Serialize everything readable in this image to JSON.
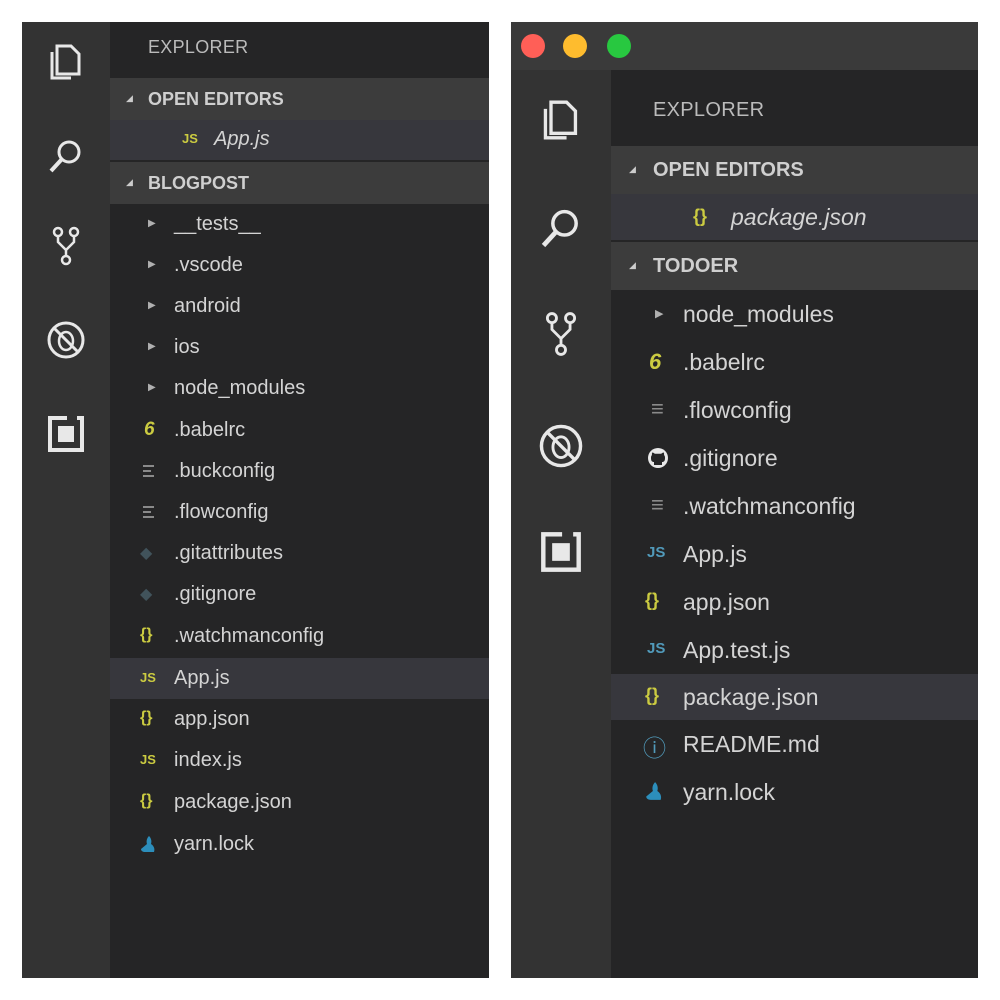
{
  "left": {
    "explorer_title": "EXPLORER",
    "open_editors": {
      "label": "OPEN EDITORS",
      "files": [
        {
          "icon": "js-icon",
          "badge": "JS",
          "name": "App.js"
        }
      ]
    },
    "project": {
      "label": "BLOGPOST",
      "items": [
        {
          "icon": "chevron-right-icon",
          "badge": "▶",
          "name": "__tests__",
          "type": "folder"
        },
        {
          "icon": "chevron-right-icon",
          "badge": "▶",
          "name": ".vscode",
          "type": "folder"
        },
        {
          "icon": "chevron-right-icon",
          "badge": "▶",
          "name": "android",
          "type": "folder"
        },
        {
          "icon": "chevron-right-icon",
          "badge": "▶",
          "name": "ios",
          "type": "folder"
        },
        {
          "icon": "chevron-right-icon",
          "badge": "▶",
          "name": "node_modules",
          "type": "folder"
        },
        {
          "icon": "babel-icon",
          "badge": "6",
          "name": ".babelrc"
        },
        {
          "icon": "config-file-icon",
          "badge": "",
          "name": ".buckconfig"
        },
        {
          "icon": "config-file-icon",
          "badge": "",
          "name": ".flowconfig"
        },
        {
          "icon": "git-icon",
          "badge": "◆",
          "name": ".gitattributes"
        },
        {
          "icon": "git-icon",
          "badge": "◆",
          "name": ".gitignore"
        },
        {
          "icon": "json-icon",
          "badge": "{}",
          "name": ".watchmanconfig"
        },
        {
          "icon": "js-icon",
          "badge": "JS",
          "name": "App.js",
          "selected": true
        },
        {
          "icon": "json-icon",
          "badge": "{}",
          "name": "app.json"
        },
        {
          "icon": "js-icon",
          "badge": "JS",
          "name": "index.js"
        },
        {
          "icon": "json-icon",
          "badge": "{}",
          "name": "package.json"
        },
        {
          "icon": "yarn-icon",
          "badge": "",
          "name": "yarn.lock"
        }
      ]
    }
  },
  "right": {
    "explorer_title": "EXPLORER",
    "open_editors": {
      "label": "OPEN EDITORS",
      "files": [
        {
          "icon": "json-icon",
          "badge": "{}",
          "name": "package.json"
        }
      ]
    },
    "project": {
      "label": "TODOER",
      "items": [
        {
          "icon": "chevron-right-icon",
          "badge": "▶",
          "name": "node_modules",
          "type": "folder"
        },
        {
          "icon": "babel-icon",
          "badge": "6",
          "name": ".babelrc"
        },
        {
          "icon": "config-file-icon",
          "badge": "≡",
          "name": ".flowconfig"
        },
        {
          "icon": "github-icon",
          "badge": "",
          "name": ".gitignore"
        },
        {
          "icon": "config-file-icon",
          "badge": "≡",
          "name": ".watchmanconfig"
        },
        {
          "icon": "js-icon",
          "badge": "JS",
          "name": "App.js"
        },
        {
          "icon": "json-icon",
          "badge": "{}",
          "name": "app.json"
        },
        {
          "icon": "js-icon",
          "badge": "JS",
          "name": "App.test.js"
        },
        {
          "icon": "json-icon",
          "badge": "{}",
          "name": "package.json",
          "selected": true
        },
        {
          "icon": "info-icon",
          "badge": "ⓘ",
          "name": "README.md"
        },
        {
          "icon": "yarn-icon",
          "badge": "",
          "name": "yarn.lock"
        }
      ]
    }
  },
  "colors": {
    "activity_bar": "#333333",
    "sidebar": "#252526",
    "section_header": "#3c3c3c",
    "selection": "#37373d",
    "js_yellow": "#cbcb41",
    "js_blue": "#519aba",
    "traffic_red": "#ff5f57",
    "traffic_yellow": "#febc2e",
    "traffic_green": "#28c840"
  }
}
